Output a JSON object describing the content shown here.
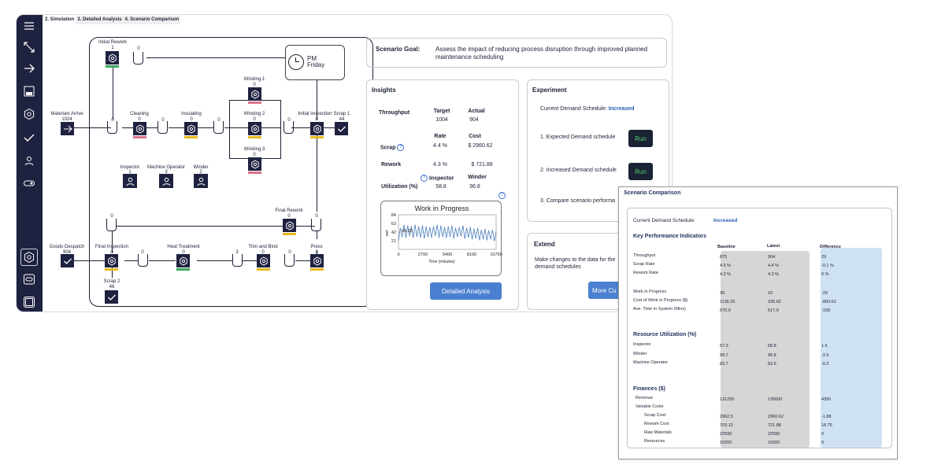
{
  "tabs": [
    "2. Simulation",
    "3. Detailed Analysis",
    "4. Scenario Comparison"
  ],
  "sidebar": {
    "icons": [
      "menu-icon",
      "expand-icon",
      "arrow-right-icon",
      "save-icon",
      "gear-icon",
      "check-icon",
      "person-icon",
      "toggle-icon",
      "gear-icon",
      "settings-window-icon",
      "window-icon"
    ]
  },
  "flow": {
    "labels": {
      "initial_rework": "Initial Rework",
      "initial_rework_n": "1",
      "top_queue": "0",
      "materials": "Materials Arrive",
      "materials_n": "1024",
      "q1": "0",
      "cleaning": "Cleaning",
      "cleaning_n": "0",
      "q2": "0",
      "insulating": "Insulating",
      "insulating_n": "0",
      "q3": "0",
      "winding1": "Winding 1",
      "winding1_n": "0",
      "winding2": "Winding 2",
      "winding2_n": "0",
      "winding3": "Winding 3",
      "winding3_n": "0",
      "q4": "0",
      "initial_inspection": "Initial Inspection",
      "initial_inspection_n": "0",
      "scrap1": "Scrap 1",
      "scrap1_n": "44",
      "inspector": "Inspector",
      "inspector_n": "1",
      "machine_operator": "Machine Operator",
      "machine_operator_n": "3",
      "winder": "Winder",
      "winder_n": "2",
      "final_rework_q": "0",
      "final_rework": "Final Rework",
      "final_rework_n": "0",
      "q_final_rework": "0",
      "goods_despatch": "Goods Despatch",
      "goods_despatch_n": "904",
      "final_inspection": "Final Inspection",
      "final_inspection_n": "0",
      "q5": "0",
      "heat_treatment": "Heat Treatment",
      "heat_treatment_n": "0",
      "q6": "3",
      "trim_bind": "Trim and Bind",
      "trim_bind_n": "0",
      "q7": "0",
      "press": "Press",
      "press_n": "0",
      "scrap2": "Scrap 2",
      "scrap2_n": "46"
    },
    "clock": {
      "line1": "PM",
      "line2": "Friday"
    },
    "colors": {
      "pink": "#d9748a",
      "yellow": "#e6b91e",
      "green": "#3aa55d"
    }
  },
  "goal": {
    "label": "Scenario Goal:",
    "text": "Assess the impact of reducing process disruption through improved planned maintenance scheduling"
  },
  "insights": {
    "title": "Insights",
    "throughput": "Throughput",
    "target_h": "Target",
    "actual_h": "Actual",
    "target": "1004",
    "actual": "904",
    "rate_h": "Rate",
    "cost_h": "Cost",
    "scrap": "Scrap",
    "scrap_rate": "4.4 %",
    "scrap_cost": "$ 2960.62",
    "rework": "Rework",
    "rework_rate": "4.3 %",
    "rework_cost": "$ 721.88",
    "inspector_h": "Inspector",
    "winder_h": "Winder",
    "utilization": "Utilization (%)",
    "util_inspector": "58.8",
    "util_winder": "96.8",
    "button": "Detailed Analysis"
  },
  "chart_data": {
    "type": "line",
    "title": "Work in Progress",
    "xlabel": "Time (minutes)",
    "ylabel": "WIP",
    "xlim": [
      0,
      10799
    ],
    "ylim": [
      0,
      84
    ],
    "xticks": [
      "0",
      "2700",
      "5400",
      "8100",
      "10799"
    ],
    "yticks": [
      "84",
      "63",
      "42",
      "21"
    ],
    "annotation": "40.28",
    "series": [
      {
        "values": [
          20,
          52,
          30,
          60,
          28,
          58,
          32,
          56,
          28,
          60,
          30,
          56,
          28,
          58,
          26,
          56,
          30,
          54,
          28,
          56,
          32,
          60,
          28,
          58,
          30,
          54,
          28,
          56,
          30,
          58,
          26,
          52,
          30,
          54,
          32,
          58,
          26,
          52,
          28,
          54,
          24,
          50,
          26,
          52,
          22,
          48,
          24,
          50,
          22,
          46,
          24,
          48,
          20,
          44
        ]
      }
    ]
  },
  "experiment": {
    "title": "Experiment",
    "current_label": "Current Demand Schedule:",
    "current_value": "Increased",
    "item1": "1. Expected Demand schedule",
    "run1": "Run",
    "item2": "2. Increased Demand schedule",
    "run2": "Run",
    "item3": "3. Compare scenario performa"
  },
  "extend": {
    "title": "Extend",
    "text1": "Make changes to the data for the",
    "text2": "demand schedules",
    "button": "More Cu"
  },
  "comparison": {
    "title": "Scenario Comparison",
    "current_label": "Current Demand Schedule:",
    "current_value": "Increased",
    "kpi_title": "Key Performance Indicators",
    "col_baseline": "Baseline",
    "col_latest": "Latest",
    "col_diff": "Difference",
    "rows_kpi": [
      [
        "Throughput",
        "875",
        "904",
        "29"
      ],
      [
        "Scrap Rate",
        "4.5 %",
        "4.4 %",
        "-0.1 %"
      ],
      [
        "Rework Rate",
        "4.3 %",
        "4.3 %",
        "0 %"
      ]
    ],
    "rows_wip": [
      [
        "Work in Progress",
        "39",
        "10",
        "-29"
      ],
      [
        "Cost of Work in Progress ($)",
        "1136.25",
        "335.62",
        "-800.62"
      ],
      [
        "Ave. Time in System (Mins)",
        "675.9",
        "517.9",
        "-158"
      ]
    ],
    "res_title": "Resource Utilization (%)",
    "rows_res": [
      [
        "Inspector",
        "57.3",
        "58.8",
        "1.5"
      ],
      [
        "Winder",
        "99.7",
        "96.8",
        "-2.9"
      ],
      [
        "Machine Operator",
        "83.7",
        "83.5",
        "-0.2"
      ]
    ],
    "fin_title": "Finances ($)",
    "rows_fin": [
      [
        "Revenue",
        "131250",
        "135600",
        "4350"
      ],
      [
        "Variable Costs",
        "",
        "",
        ""
      ],
      [
        "Scrap Cost",
        "2962.5",
        "2960.62",
        "-1.88"
      ],
      [
        "Rework Cost",
        "703.12",
        "721.88",
        "18.75"
      ],
      [
        "Raw Materials",
        "22590",
        "22590",
        "0"
      ],
      [
        "Resources",
        "19200",
        "19200",
        "0"
      ]
    ]
  }
}
